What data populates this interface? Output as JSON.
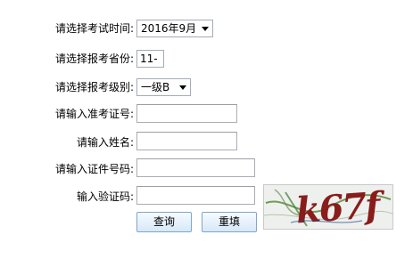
{
  "form": {
    "exam_time": {
      "label": "请选择考试时间:",
      "selected": "2016年9月"
    },
    "province": {
      "label": "请选择报考省份:",
      "value": "11-"
    },
    "level": {
      "label": "请选择报考级别:",
      "selected": "一级B"
    },
    "admission_no": {
      "label": "请输入准考证号:",
      "value": ""
    },
    "name": {
      "label": "请输入姓名:",
      "value": ""
    },
    "id_no": {
      "label": "请输入证件号码:",
      "value": ""
    },
    "captcha": {
      "label": "输入验证码:",
      "value": "",
      "image_text": "k67f"
    }
  },
  "buttons": {
    "query": "查询",
    "reset": "重填"
  }
}
